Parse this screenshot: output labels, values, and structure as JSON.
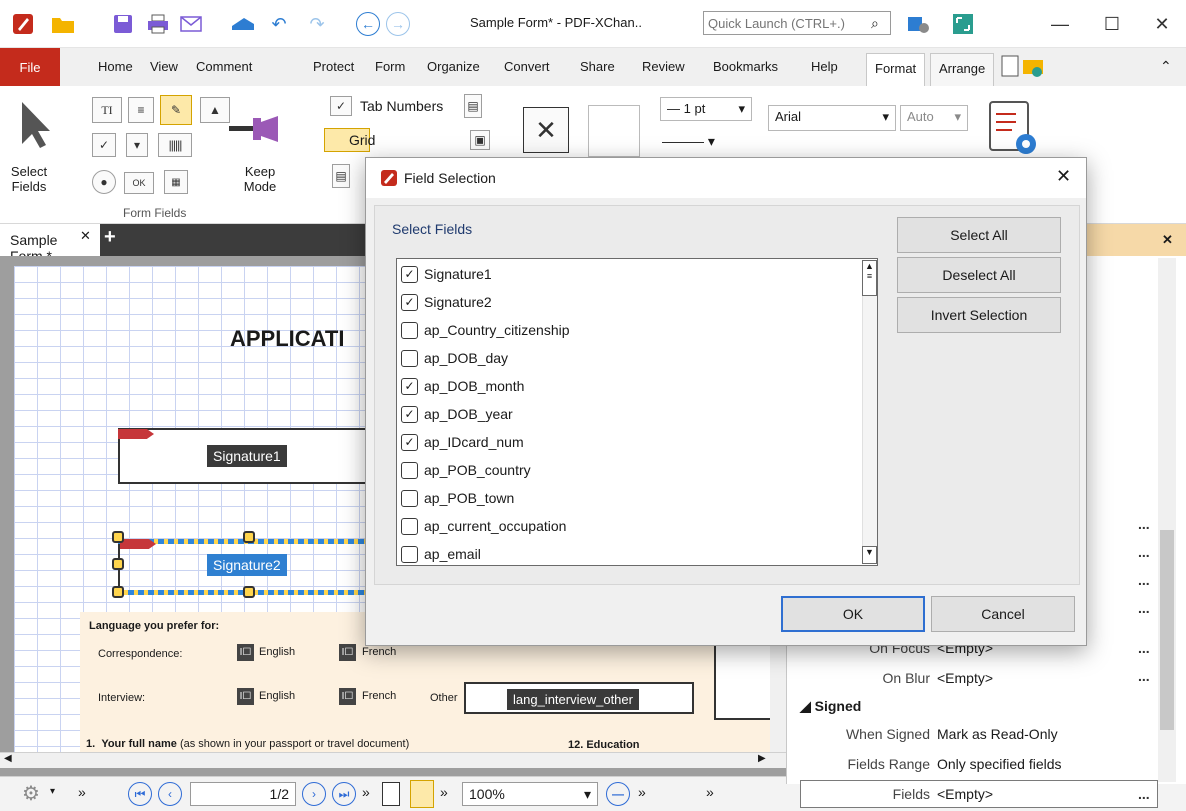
{
  "window": {
    "title": "Sample Form* - PDF-XChan..",
    "quick_launch_placeholder": "Quick Launch (CTRL+.)",
    "minimize": "—",
    "maximize": "☐",
    "close": "✕"
  },
  "menu": {
    "file": "File",
    "items": [
      "Home",
      "View",
      "Comment",
      "Protect",
      "Form",
      "Organize",
      "Convert",
      "Share",
      "Review",
      "Bookmarks",
      "Help",
      "Format",
      "Arrange"
    ],
    "selected": "Format"
  },
  "ribbon": {
    "select_fields": "Select Fields",
    "keep_mode": "Keep Mode",
    "form_fields_group": "Form Fields",
    "tab_numbers": "Tab Numbers",
    "grid": "Grid",
    "line_width": "1 pt",
    "font": "Arial",
    "font_size": "Auto"
  },
  "document": {
    "tab_label": "Sample Form *",
    "heading": "APPLICATI",
    "signature1": "Signature1",
    "signature2": "Signature2",
    "language_prefer": "Language you prefer for:",
    "correspondence": "Correspondence:",
    "interview": "Interview:",
    "english": "English",
    "french": "French",
    "other": "Other",
    "lang_interview_other": "lang_interview_other",
    "full_name_num": "1.",
    "full_name_bold": "Your full name",
    "full_name_rest": "(as shown in your passport or travel document)",
    "education": "12.  Education"
  },
  "properties": {
    "on_focus_label": "On Focus",
    "on_focus_value": "<Empty>",
    "on_blur_label": "On Blur",
    "on_blur_value": "<Empty>",
    "signed_section": "Signed",
    "when_signed_label": "When Signed",
    "when_signed_value": "Mark as Read-Only",
    "fields_range_label": "Fields Range",
    "fields_range_value": "Only specified fields",
    "fields_label": "Fields",
    "fields_value": "<Empty>"
  },
  "statusbar": {
    "page_input": "1/2",
    "zoom": "100%"
  },
  "dialog": {
    "title": "Field Selection",
    "group_label": "Select Fields",
    "select_all": "Select All",
    "deselect_all": "Deselect All",
    "invert_selection": "Invert Selection",
    "ok": "OK",
    "cancel": "Cancel",
    "fields": [
      {
        "name": "Signature1",
        "checked": true
      },
      {
        "name": "Signature2",
        "checked": true
      },
      {
        "name": "ap_Country_citizenship",
        "checked": false
      },
      {
        "name": "ap_DOB_day",
        "checked": false
      },
      {
        "name": "ap_DOB_month",
        "checked": true
      },
      {
        "name": "ap_DOB_year",
        "checked": true
      },
      {
        "name": "ap_IDcard_num",
        "checked": true
      },
      {
        "name": "ap_POB_country",
        "checked": false
      },
      {
        "name": "ap_POB_town",
        "checked": false
      },
      {
        "name": "ap_current_occupation",
        "checked": false
      },
      {
        "name": "ap_email",
        "checked": false
      }
    ]
  },
  "colors": {
    "accent": "#c42b1c",
    "dialog_primary": "#2f6fd1",
    "grid": "#c9d3f1",
    "panel_header": "#f6d9a8"
  }
}
